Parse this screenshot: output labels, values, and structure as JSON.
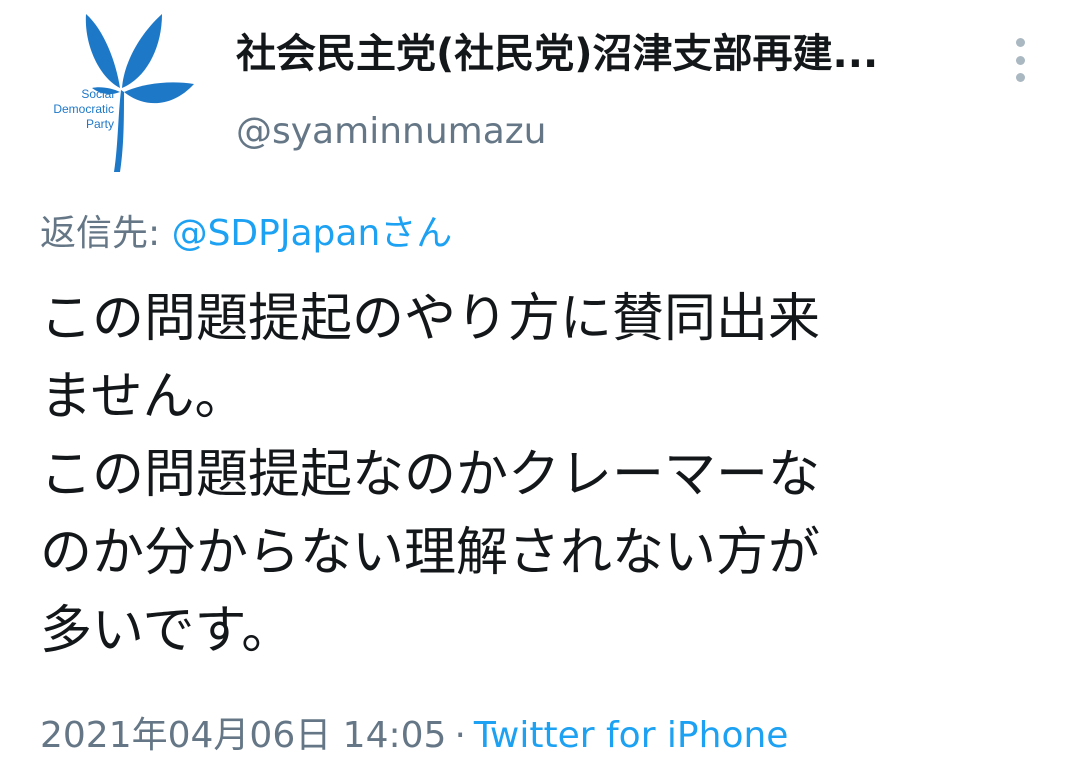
{
  "author": {
    "display_name": "社会民主党(社民党)沼津支部再建...",
    "handle": "@syaminnumazu",
    "avatar_logo_lines": [
      "Social",
      "Democratic",
      "Party"
    ]
  },
  "reply": {
    "prefix": "返信先: ",
    "mention": "@SDPJapanさん"
  },
  "tweet": {
    "lines": [
      "この問題提起のやり方に賛同出来",
      "ません。",
      "この問題提起なのかクレーマーな",
      "のか分からない理解されない方が",
      "多いです。"
    ]
  },
  "meta": {
    "timestamp": "2021年04月06日 14:05",
    "separator": "·",
    "source": "Twitter for iPhone"
  },
  "icons": {
    "more": "more-vertical-icon",
    "avatar": "sdp-logo-icon"
  },
  "colors": {
    "text_primary": "#14171a",
    "text_secondary": "#657786",
    "link_blue": "#1da1f2",
    "logo_blue": "#1e78c8"
  }
}
